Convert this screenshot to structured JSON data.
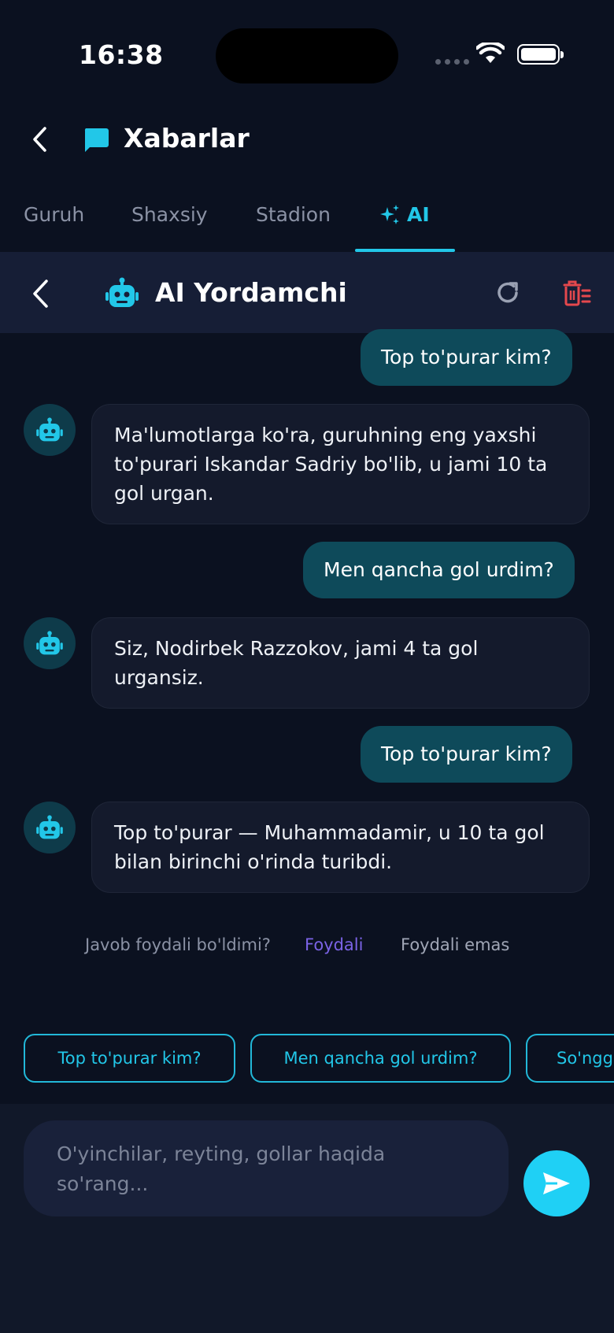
{
  "status_bar": {
    "time": "16:38"
  },
  "header": {
    "title": "Xabarlar"
  },
  "tabs": [
    {
      "label": "Guruh"
    },
    {
      "label": "Shaxsiy"
    },
    {
      "label": "Stadion"
    },
    {
      "label": "AI"
    }
  ],
  "ai_header": {
    "title": "AI Yordamchi"
  },
  "messages": [
    {
      "role": "user",
      "text": "Top to'purar kim?"
    },
    {
      "role": "bot",
      "text": "Ma'lumotlarga ko'ra, guruhning eng yaxshi to'purari Iskandar Sadriy bo'lib, u jami 10 ta gol urgan."
    },
    {
      "role": "user",
      "text": "Men qancha gol urdim?"
    },
    {
      "role": "bot",
      "text": "Siz, Nodirbek Razzokov, jami 4 ta gol urgansiz."
    },
    {
      "role": "user",
      "text": "Top to'purar kim?"
    },
    {
      "role": "bot",
      "text": "Top to'purar — Muhammadamir, u 10 ta gol bilan birinchi o'rinda turibdi."
    }
  ],
  "feedback": {
    "question": "Javob foydali bo'ldimi?",
    "positive": "Foydali",
    "negative": "Foydali emas"
  },
  "suggestions": [
    "Top to'purar kim?",
    "Men qancha gol urdim?",
    "So'ngg"
  ],
  "composer": {
    "placeholder": "O'yinchilar, reyting, gollar haqida so'rang..."
  },
  "colors": {
    "accent": "#22c7e8",
    "background": "#0b1120",
    "user_bubble": "#0e4a5a",
    "danger": "#e5484d",
    "feedback_positive": "#7b63e6"
  },
  "icons": [
    "back-icon",
    "chat-bubble-icon",
    "sparkles-icon",
    "robot-icon",
    "refresh-icon",
    "trash-icon",
    "send-icon"
  ]
}
